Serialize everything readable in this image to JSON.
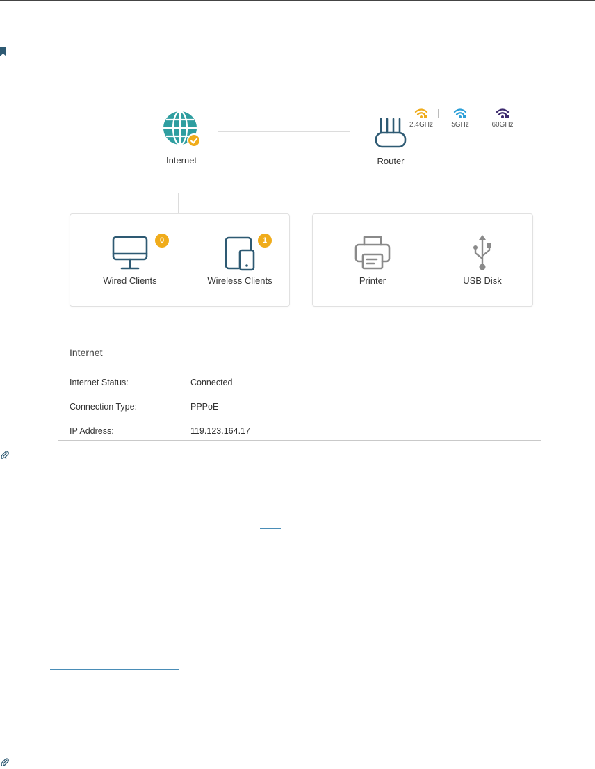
{
  "topology": {
    "internet_label": "Internet",
    "router_label": "Router",
    "bands": [
      {
        "label": "2.4GHz",
        "color": "#f0ac1b"
      },
      {
        "label": "5GHz",
        "color": "#2b9fd8"
      },
      {
        "label": "60GHz",
        "color": "#3d2a6e"
      }
    ],
    "devices": [
      {
        "label": "Wired Clients",
        "count": "0",
        "icon": "monitor-icon"
      },
      {
        "label": "Wireless Clients",
        "count": "1",
        "icon": "tablet-phone-icon"
      },
      {
        "label": "Printer",
        "icon": "printer-icon"
      },
      {
        "label": "USB Disk",
        "icon": "usb-icon"
      }
    ]
  },
  "internet_section": {
    "title": "Internet",
    "rows": [
      {
        "key": "Internet Status:",
        "value": "Connected"
      },
      {
        "key": "Connection Type:",
        "value": "PPPoE"
      },
      {
        "key": "IP Address:",
        "value": "119.123.164.17"
      }
    ]
  },
  "colors": {
    "accent_teal": "#2f9ea0",
    "icon_dark": "#2e5a73",
    "badge": "#f0ac1b",
    "muted_icon": "#8a8a8a"
  }
}
